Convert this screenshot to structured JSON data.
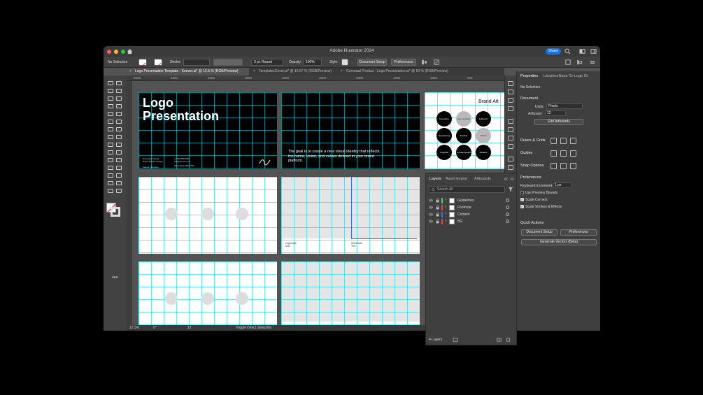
{
  "window": {
    "title": "Adobe Illustrator 2024",
    "share_label": "Share"
  },
  "control": {
    "selection": "No Selection",
    "stroke_label": "Stroke:",
    "stroke_style": "3 pt. Round",
    "opacity_label": "Opacity:",
    "opacity_value": "100%",
    "style_label": "Style:",
    "doc_setup": "Document Setup",
    "preferences": "Preferences"
  },
  "tabs": [
    {
      "label": "Logo Presentation Template - Keever.ai* @ 12.5 % (RGB/Preview)"
    },
    {
      "label": "TemplatesCover.ai* @ 16.67 % (RGB/Preview)"
    },
    {
      "label": "Gumroad Product - Logo Presentation.ai* @ 50 % (RGB/Preview)"
    }
  ],
  "ruler": {
    "ticks": [
      "5000",
      "4500",
      "4000",
      "3500",
      "3000",
      "2500",
      "2000",
      "1500",
      "1000",
      "500"
    ]
  },
  "artboards": {
    "cover_title": "Logo\nPresentation",
    "company_info": "[Company Name]\nBrand Identity Design\n\nKeever Okomoto\nJohn Anderson",
    "contact_info": "+1 555 555 555\ninfo@keever.com",
    "date_info": "September 30th 2024",
    "goal_text": "The goal is to create a new visual identity that reflects the name, vision, and values defined in your brand platform.",
    "brand_title": "Brand Att",
    "brand_circles": [
      "Innovative",
      "Approachable",
      "Authentic",
      "Empowering",
      "Flexible",
      "Vibrant",
      "Insightful",
      "Knowledgeable",
      "Reliable"
    ],
    "labels_left": [
      "Logomark",
      "Icon"
    ],
    "labels_right": [
      "Wordmark",
      "Text"
    ]
  },
  "status": {
    "zoom": "12.5%",
    "rotation": "0°",
    "artboard_num": "12",
    "toggle": "Toggle Direct Selection"
  },
  "properties": {
    "tabs": [
      "Properties",
      "Libraries",
      "Base Gr",
      "Logo Gr"
    ],
    "no_selection": "No Selection",
    "document_heading": "Document",
    "units_label": "Units:",
    "units_value": "Pixels",
    "artboard_label": "Artboard:",
    "artboard_value": "12",
    "edit_artboards": "Edit Artboards",
    "rulers_heading": "Rulers & Grids",
    "guides_heading": "Guides",
    "snap_heading": "Snap Options",
    "prefs_heading": "Preferences",
    "keyboard_label": "Keyboard Increment:",
    "keyboard_value": "1 px",
    "checks": [
      {
        "label": "Use Preview Bounds",
        "checked": false
      },
      {
        "label": "Scale Corners",
        "checked": true
      },
      {
        "label": "Scale Strokes & Effects",
        "checked": true
      }
    ],
    "quick_heading": "Quick Actions",
    "qa_doc_setup": "Document Setup",
    "qa_prefs": "Preferences",
    "qa_generate": "Generate Vectors (Beta)"
  },
  "layers": {
    "tabs": [
      "Layers",
      "Asset Export",
      "Artboards"
    ],
    "search_placeholder": "Search All",
    "items": [
      {
        "name": "Guidelines",
        "color": "#4dd85a"
      },
      {
        "name": "Footnote",
        "color": "#e84040"
      },
      {
        "name": "Content",
        "color": "#3a6ee8"
      },
      {
        "name": "BG",
        "color": "#e84040"
      }
    ],
    "count": "4 Layers"
  }
}
